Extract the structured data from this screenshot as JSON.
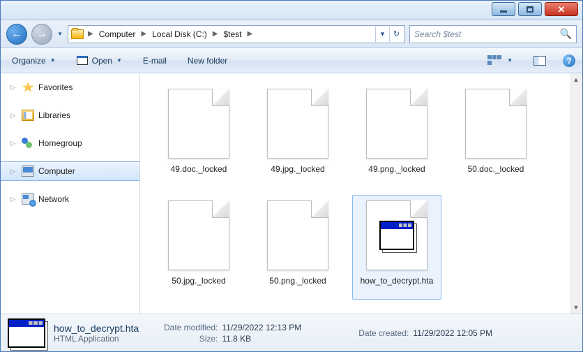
{
  "breadcrumb": {
    "items": [
      "Computer",
      "Local Disk (C:)",
      "$test"
    ]
  },
  "search": {
    "placeholder": "Search $test"
  },
  "toolbar": {
    "organize": "Organize",
    "open": "Open",
    "email": "E-mail",
    "newfolder": "New folder"
  },
  "nav": {
    "favorites": "Favorites",
    "libraries": "Libraries",
    "homegroup": "Homegroup",
    "computer": "Computer",
    "network": "Network"
  },
  "files": [
    {
      "name": "49.doc._locked",
      "selected": false,
      "kind": "locked"
    },
    {
      "name": "49.jpg._locked",
      "selected": false,
      "kind": "locked"
    },
    {
      "name": "49.png._locked",
      "selected": false,
      "kind": "locked"
    },
    {
      "name": "50.doc._locked",
      "selected": false,
      "kind": "locked"
    },
    {
      "name": "50.jpg._locked",
      "selected": false,
      "kind": "locked"
    },
    {
      "name": "50.png._locked",
      "selected": false,
      "kind": "locked"
    },
    {
      "name": "how_to_decrypt.hta",
      "selected": true,
      "kind": "hta"
    }
  ],
  "details": {
    "name": "how_to_decrypt.hta",
    "type": "HTML Application",
    "modified_label": "Date modified:",
    "modified": "11/29/2022 12:13 PM",
    "size_label": "Size:",
    "size": "11.8 KB",
    "created_label": "Date created:",
    "created": "11/29/2022 12:05 PM"
  }
}
